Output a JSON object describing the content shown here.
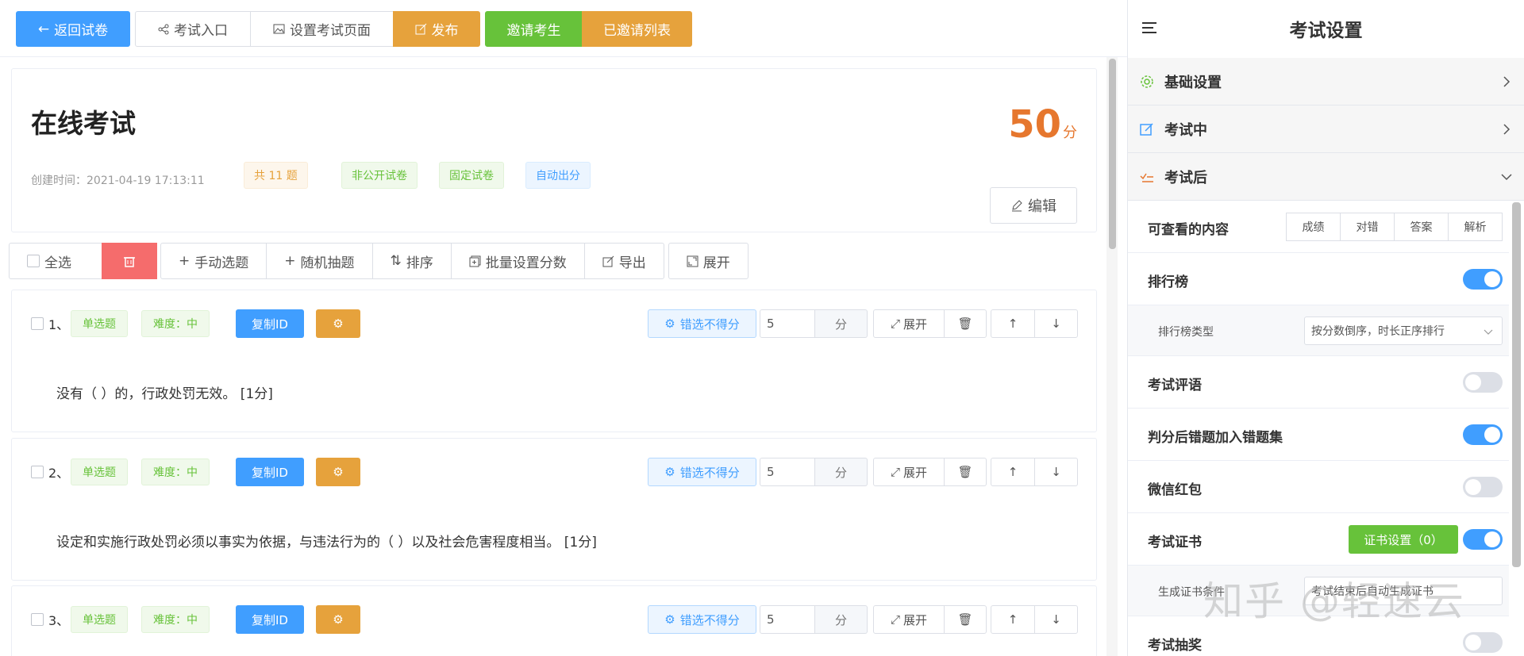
{
  "toolbar": {
    "back": "返回试卷",
    "entry": "考试入口",
    "setup_page": "设置考试页面",
    "publish": "发布",
    "invite": "邀请考生",
    "invited_list": "已邀请列表"
  },
  "exam": {
    "title": "在线考试",
    "score": "50",
    "score_unit": "分",
    "created": "创建时间：2021-04-19 17:13:11",
    "tags": [
      "共 11 题",
      "非公开试卷",
      "固定试卷",
      "自动出分"
    ],
    "edit": "编辑"
  },
  "actions": {
    "select_all": "全选",
    "manual": "手动选题",
    "random": "随机抽题",
    "sort": "排序",
    "batch_score": "批量设置分数",
    "export": "导出",
    "expand": "展开"
  },
  "questions": [
    {
      "num": "1、",
      "type": "单选题",
      "difficulty": "难度：中",
      "copy_id": "复制ID",
      "wrong_no_score": "错选不得分",
      "score": "5",
      "unit": "分",
      "expand": "展开",
      "text": "没有（  ）的，行政处罚无效。 [1分]"
    },
    {
      "num": "2、",
      "type": "单选题",
      "difficulty": "难度：中",
      "copy_id": "复制ID",
      "wrong_no_score": "错选不得分",
      "score": "5",
      "unit": "分",
      "expand": "展开",
      "text": "设定和实施行政处罚必须以事实为依据，与违法行为的（    ）以及社会危害程度相当。 [1分]"
    },
    {
      "num": "3、",
      "type": "单选题",
      "difficulty": "难度：中",
      "copy_id": "复制ID",
      "wrong_no_score": "错选不得分",
      "score": "5",
      "unit": "分",
      "expand": "展开",
      "text": ""
    }
  ],
  "panel": {
    "title": "考试设置",
    "sections": [
      "基础设置",
      "考试中",
      "考试后"
    ],
    "viewable_label": "可查看的内容",
    "viewable_options": [
      "成绩",
      "对错",
      "答案",
      "解析"
    ],
    "ranking": "排行榜",
    "ranking_on": true,
    "ranking_type_label": "排行榜类型",
    "ranking_type_value": "按分数倒序，时长正序排行",
    "comment": "考试评语",
    "comment_on": false,
    "wrong_set": "判分后错题加入错题集",
    "wrong_set_on": true,
    "red_packet": "微信红包",
    "red_packet_on": false,
    "certificate": "考试证书",
    "certificate_on": true,
    "cert_btn": "证书设置（0）",
    "gen_cert_label": "生成证书条件",
    "gen_cert_value": "考试结束后自动生成证书",
    "lottery": "考试抽奖",
    "lottery_on": false
  },
  "watermark": "知乎 @轻速云",
  "colors": {
    "primary": "#409eff",
    "warning": "#e6a23c",
    "success": "#67c23a",
    "danger": "#f56c6c",
    "score": "#e6772e"
  }
}
